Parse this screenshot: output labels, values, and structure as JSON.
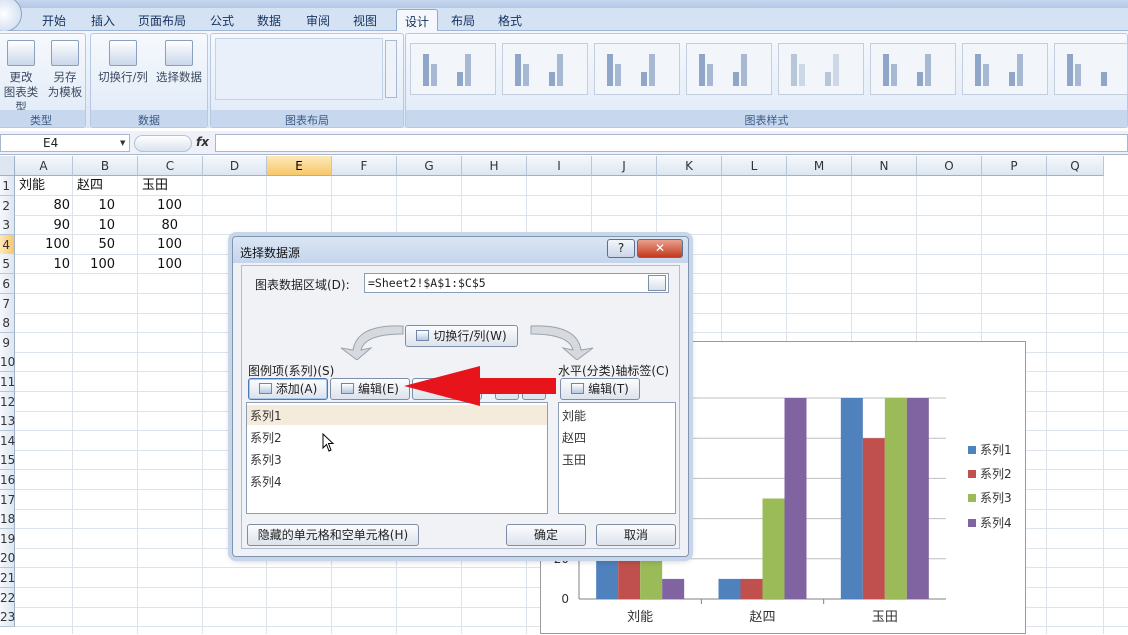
{
  "ribbon": {
    "tabs": [
      "开始",
      "插入",
      "页面布局",
      "公式",
      "数据",
      "审阅",
      "视图",
      "设计",
      "布局",
      "格式"
    ],
    "active_tab": "设计",
    "buttons": {
      "change_type": "更改\n图表类型",
      "save_template": "另存\n为模板",
      "switch_row_col": "切换行/列",
      "select_data": "选择数据"
    },
    "groups": [
      "类型",
      "数据",
      "图表布局",
      "图表样式"
    ]
  },
  "formula_bar": {
    "name_box": "E4",
    "fx": "fx",
    "formula": ""
  },
  "sheet": {
    "columns": [
      "A",
      "B",
      "C",
      "D",
      "E",
      "F",
      "G",
      "H",
      "I",
      "J",
      "K",
      "L",
      "M",
      "N",
      "O",
      "P",
      "Q"
    ],
    "selected_column": "E",
    "rows": [
      "1",
      "2",
      "3",
      "4",
      "5",
      "6",
      "7",
      "8",
      "9",
      "10",
      "11",
      "12",
      "13",
      "14",
      "15",
      "16",
      "17",
      "18",
      "19",
      "20",
      "21",
      "22",
      "23"
    ],
    "selected_row": "4",
    "headers": [
      "刘能",
      "赵四",
      "玉田"
    ],
    "values": [
      [
        "80",
        "10",
        "100"
      ],
      [
        "90",
        "10",
        "80"
      ],
      [
        "100",
        "50",
        "100"
      ],
      [
        "10",
        "100",
        "100"
      ]
    ]
  },
  "dialog": {
    "title": "选择数据源",
    "help": "?",
    "close": "✕",
    "range_label": "图表数据区域(D):",
    "range_value": "=Sheet2!$A$1:$C$5",
    "switch_button": "切换行/列(W)",
    "legend_label": "图例项(系列)(S)",
    "add_button": "添加(A)",
    "edit_button": "编辑(E)",
    "series": [
      "系列1",
      "系列2",
      "系列3",
      "系列4"
    ],
    "axis_label": "水平(分类)轴标签(C)",
    "axis_edit_button": "编辑(T)",
    "categories": [
      "刘能",
      "赵四",
      "玉田"
    ],
    "hidden_cells_button": "隐藏的单元格和空单元格(H)",
    "ok_button": "确定",
    "cancel_button": "取消"
  },
  "chart_data": {
    "type": "bar",
    "categories": [
      "刘能",
      "赵四",
      "玉田"
    ],
    "series": [
      {
        "name": "系列1",
        "values": [
          80,
          10,
          100
        ],
        "color": "#4f81bd"
      },
      {
        "name": "系列2",
        "values": [
          90,
          10,
          80
        ],
        "color": "#c0504d"
      },
      {
        "name": "系列3",
        "values": [
          100,
          50,
          100
        ],
        "color": "#9bbb59"
      },
      {
        "name": "系列4",
        "values": [
          10,
          100,
          100
        ],
        "color": "#8064a2"
      }
    ],
    "ylim": [
      0,
      100
    ],
    "yticks": [
      "0",
      "20"
    ],
    "grid": true,
    "legend": "right"
  },
  "colors": {
    "accent": "#4f81bd",
    "arrow": "#e8141b",
    "selected_header": "#f7c76b"
  }
}
